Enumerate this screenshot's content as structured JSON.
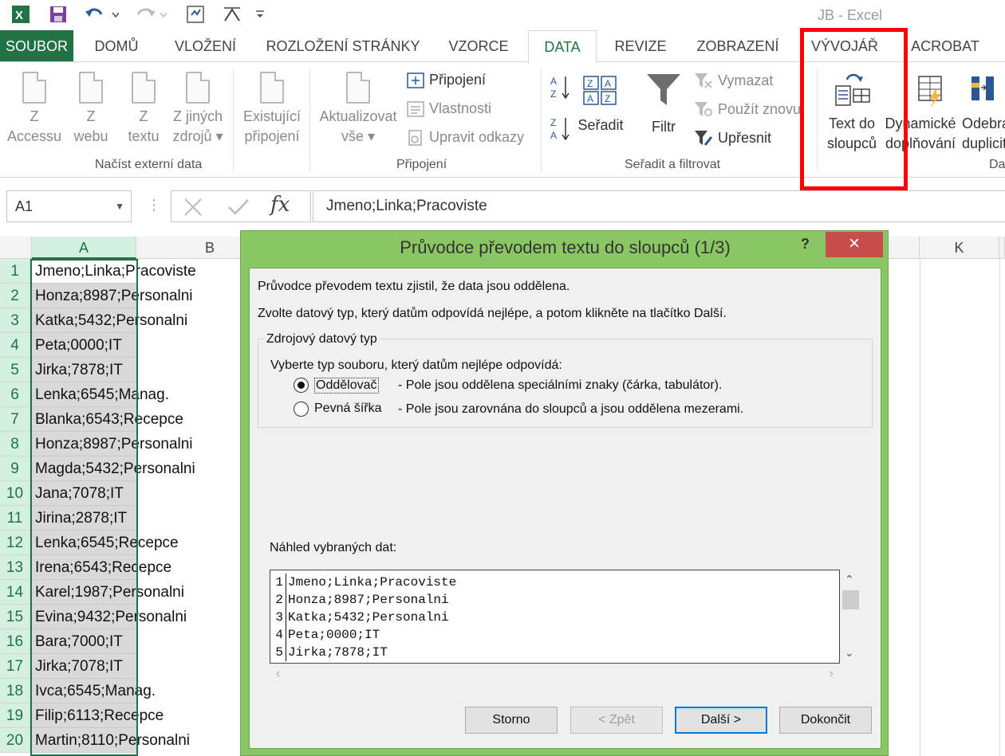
{
  "window": {
    "title": "JB - Excel"
  },
  "qat": {
    "excel_icon": "excel-icon",
    "save_icon": "save-icon",
    "undo_icon": "undo-icon",
    "redo_icon": "redo-icon"
  },
  "tabs": [
    {
      "label": "SOUBOR"
    },
    {
      "label": "DOMŮ"
    },
    {
      "label": "VLOŽENÍ"
    },
    {
      "label": "ROZLOŽENÍ STRÁNKY"
    },
    {
      "label": "VZORCE"
    },
    {
      "label": "DATA"
    },
    {
      "label": "REVIZE"
    },
    {
      "label": "ZOBRAZENÍ"
    },
    {
      "label": "VÝVOJÁŘ"
    },
    {
      "label": "ACROBAT"
    }
  ],
  "ribbon": {
    "external": {
      "access_l1": "Z",
      "access_l2": "Accessu",
      "web_l1": "Z",
      "web_l2": "webu",
      "text_l1": "Z",
      "text_l2": "textu",
      "other_l1": "Z jiných",
      "other_l2": "zdrojů ▾",
      "existing_l1": "Existující",
      "existing_l2": "připojení",
      "group": "Načíst externí data"
    },
    "connections": {
      "refresh_l1": "Aktualizovat",
      "refresh_l2": "vše ▾",
      "connections": "Připojení",
      "properties": "Vlastnosti",
      "edit_links": "Upravit odkazy",
      "group": "Připojení"
    },
    "sort": {
      "sort": "Seřadit",
      "filter": "Filtr",
      "clear": "Vymazat",
      "reapply": "Použít znovu",
      "advanced": "Upřesnit",
      "group": "Seřadit a filtrovat"
    },
    "tools": {
      "ttc_l1": "Text do",
      "ttc_l2": "sloupců",
      "flash_l1": "Dynamické",
      "flash_l2": "doplňování",
      "dup_l1": "Odebrat",
      "dup_l2": "duplicity",
      "group": "Da"
    }
  },
  "formula_bar": {
    "name_box": "A1",
    "formula": "Jmeno;Linka;Pracoviste",
    "fx": "fx"
  },
  "grid": {
    "columns": [
      "A",
      "B",
      "K"
    ],
    "rows": [
      "Jmeno;Linka;Pracoviste",
      "Honza;8987;Personalni",
      "Katka;5432;Personalni",
      "Peta;0000;IT",
      "Jirka;7878;IT",
      "Lenka;6545;Manag.",
      "Blanka;6543;Recepce",
      "Honza;8987;Personalni",
      "Magda;5432;Personalni",
      "Jana;7078;IT",
      "Jirina;2878;IT",
      "Lenka;6545;Recepce",
      "Irena;6543;Recepce",
      "Karel;1987;Personalni",
      "Evina;9432;Personalni",
      "Bara;7000;IT",
      "Jirka;7078;IT",
      "Ivca;6545;Manag.",
      "Filip;6113;Recepce",
      "Martin;8110;Personalni"
    ]
  },
  "dialog": {
    "title": "Průvodce převodem textu do sloupců (1/3)",
    "help": "?",
    "close": "×",
    "line1": "Průvodce převodem textu zjistil, že data jsou oddělena.",
    "line2": "Zvolte datový typ, který datům odpovídá nejlépe, a potom klikněte na tlačítko Další.",
    "fieldset_legend": "Zdrojový datový typ",
    "prompt": "Vyberte typ souboru, který datům nejlépe odpovídá:",
    "opt1_label": "Oddělovač",
    "opt1_desc": "- Pole jsou oddělena speciálními znaky (čárka, tabulátor).",
    "opt2_label": "Pevná šířka",
    "opt2_desc": "- Pole jsou zarovnána do sloupců a jsou oddělena mezerami.",
    "preview_label": "Náhled vybraných dat:",
    "preview": [
      {
        "n": "1",
        "t": "Jmeno;Linka;Pracoviste"
      },
      {
        "n": "2",
        "t": "Honza;8987;Personalni"
      },
      {
        "n": "3",
        "t": "Katka;5432;Personalni"
      },
      {
        "n": "4",
        "t": "Peta;0000;IT"
      },
      {
        "n": "5",
        "t": "Jirka;7878;IT"
      }
    ],
    "buttons": {
      "cancel": "Storno",
      "back": "< Zpět",
      "next": "Další >",
      "finish": "Dokončit"
    }
  }
}
